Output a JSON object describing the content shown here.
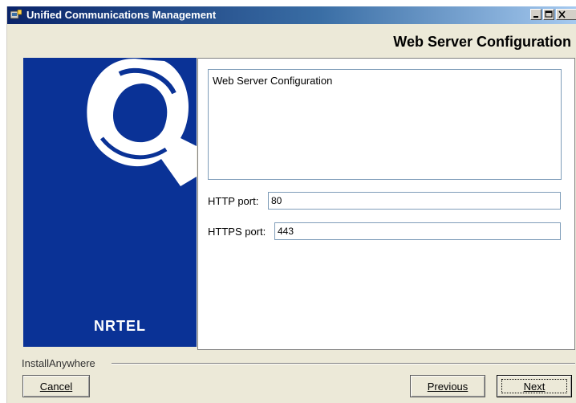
{
  "window": {
    "title": "Unified Communications Management",
    "icon": "installer-icon",
    "controls": [
      "minimize-icon",
      "maximize-icon",
      "close-icon"
    ]
  },
  "header": {
    "title": "Web Server Configuration"
  },
  "branding": {
    "company": "NRTEL",
    "logo_icon": "nortel-globe-icon",
    "panel_color": "#0a3296"
  },
  "content": {
    "description": "Web Server Configuration",
    "fields": [
      {
        "label": "HTTP port:",
        "value": "80"
      },
      {
        "label": "HTTPS port:",
        "value": "443"
      }
    ]
  },
  "footer": {
    "installer_label": "InstallAnywhere",
    "cancel_label": "Cancel",
    "previous_label": "Previous",
    "next_label": "Next"
  }
}
